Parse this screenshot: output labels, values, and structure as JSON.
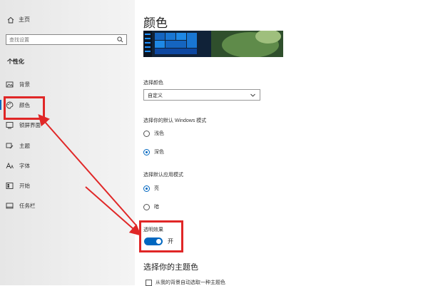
{
  "sidebar": {
    "home_label": "主页",
    "search_placeholder": "查找设置",
    "section_title": "个性化",
    "items": [
      {
        "label": "背景",
        "icon": "picture-icon"
      },
      {
        "label": "颜色",
        "icon": "palette-icon",
        "selected": true
      },
      {
        "label": "锁屏界面",
        "icon": "lock-screen-icon"
      },
      {
        "label": "主题",
        "icon": "brush-icon"
      },
      {
        "label": "字体",
        "icon": "font-icon"
      },
      {
        "label": "开始",
        "icon": "start-icon"
      },
      {
        "label": "任务栏",
        "icon": "taskbar-icon"
      }
    ]
  },
  "main": {
    "title": "颜色",
    "choose_color_label": "选择颜色",
    "choose_color_value": "自定义",
    "windows_mode_label": "选择你的默认 Windows 模式",
    "windows_mode_options": [
      {
        "label": "浅色",
        "selected": false
      },
      {
        "label": "深色",
        "selected": true
      }
    ],
    "app_mode_label": "选择默认应用模式",
    "app_mode_options": [
      {
        "label": "亮",
        "selected": true
      },
      {
        "label": "暗",
        "selected": false
      }
    ],
    "transparency_label": "透明效果",
    "transparency_state": "开",
    "transparency_on": true,
    "theme_color_title": "选择你的主题色",
    "auto_color_checkbox_label": "从我的背景自动选取一种主题色"
  },
  "colors": {
    "accent": "#0067c0",
    "annotation": "#e02727"
  }
}
